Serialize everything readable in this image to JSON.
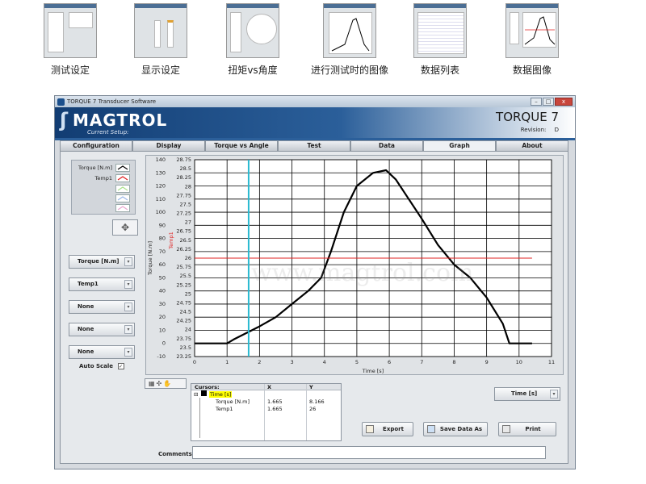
{
  "thumbnails": [
    {
      "label": "测试设定"
    },
    {
      "label": "显示设定"
    },
    {
      "label": "扭矩vs角度"
    },
    {
      "label": "进行测试时的图像"
    },
    {
      "label": "数据列表"
    },
    {
      "label": "数据图像"
    }
  ],
  "window": {
    "title": "TORQUE 7 Transducer Software",
    "buttons": {
      "minimize": "–",
      "maximize": "□",
      "close": "x"
    }
  },
  "banner": {
    "brand": "MAGTROL",
    "current_setup_label": "Current Setup:",
    "product": "TORQUE 7",
    "revision_label": "Revision:",
    "revision_value": "D"
  },
  "tabs": [
    {
      "label": "Configuration",
      "active": false
    },
    {
      "label": "Display",
      "active": false
    },
    {
      "label": "Torque vs Angle",
      "active": false
    },
    {
      "label": "Test",
      "active": false
    },
    {
      "label": "Data",
      "active": false
    },
    {
      "label": "Graph",
      "active": true
    },
    {
      "label": "About",
      "active": false
    }
  ],
  "legend": {
    "items": [
      {
        "label": "Torque [N.m]",
        "color": "#000000"
      },
      {
        "label": "Temp1",
        "color": "#e02020"
      },
      {
        "label": "",
        "color": "#a8e08a"
      },
      {
        "label": "",
        "color": "#9ab8e8"
      },
      {
        "label": "",
        "color": "#e8a8d0"
      }
    ],
    "pan_icon": "pan-tool-icon"
  },
  "channel_selectors": [
    {
      "value": "Torque [N.m]"
    },
    {
      "value": "Temp1"
    },
    {
      "value": "None"
    },
    {
      "value": "None"
    },
    {
      "value": "None"
    }
  ],
  "auto_scale": {
    "label": "Auto Scale",
    "checked": "✓"
  },
  "chart_data": {
    "type": "line",
    "xlabel": "Time [s]",
    "ylabel_left": "Torque [N.m]",
    "ylabel_right": "Temp1",
    "xlim": [
      0,
      11
    ],
    "ylim_left": [
      -10,
      140
    ],
    "ylim_right": [
      23.25,
      28.75
    ],
    "x_ticks": [
      0,
      1,
      2,
      3,
      4,
      5,
      6,
      7,
      8,
      9,
      10,
      11
    ],
    "y_ticks_left": [
      -10,
      0,
      10,
      20,
      30,
      40,
      50,
      60,
      70,
      80,
      90,
      100,
      110,
      120,
      130,
      140
    ],
    "y_ticks_right": [
      "23.25",
      "23.5",
      "23.75",
      "24",
      "24.25",
      "24.5",
      "24.75",
      "25",
      "25.25",
      "25.5",
      "25.75",
      "26",
      "26.25",
      "26.5",
      "26.75",
      "27",
      "27.25",
      "27.5",
      "27.75",
      "28",
      "28.25",
      "28.5",
      "28.75"
    ],
    "grid": true,
    "series": [
      {
        "name": "Torque [N.m]",
        "axis": "left",
        "color": "#000000",
        "x": [
          0,
          1.0,
          1.2,
          2.0,
          2.5,
          3.0,
          3.5,
          3.9,
          4.2,
          4.6,
          5.0,
          5.5,
          5.9,
          6.2,
          6.6,
          7.0,
          7.5,
          8.0,
          8.5,
          9.0,
          9.5,
          9.7,
          10.0,
          10.4
        ],
        "y": [
          0,
          0,
          3,
          13,
          20,
          30,
          40,
          50,
          70,
          100,
          120,
          130,
          132,
          125,
          110,
          95,
          75,
          60,
          50,
          35,
          15,
          0,
          0,
          0
        ]
      },
      {
        "name": "Temp1",
        "axis": "right",
        "color": "#e02020",
        "x": [
          0,
          10.4
        ],
        "y": [
          26,
          26
        ]
      }
    ],
    "cursor_x": 1.665,
    "cursor_color": "#29b9d0"
  },
  "plot_tools": {
    "label": "▦✣✋"
  },
  "cursors_table": {
    "headers": [
      "Cursors:",
      "X",
      "Y"
    ],
    "group": "Time [s]",
    "rows": [
      {
        "name": "Torque [N.m]",
        "x": "1.665",
        "y": "8.166"
      },
      {
        "name": "Temp1",
        "x": "1.665",
        "y": "26"
      }
    ]
  },
  "x_axis_selector": {
    "value": "Time [s]"
  },
  "buttons": {
    "export": "Export",
    "save_data_as": "Save Data As",
    "print": "Print"
  },
  "comments": {
    "label": "Comments",
    "value": ""
  },
  "watermark": "www.magtrol.com"
}
